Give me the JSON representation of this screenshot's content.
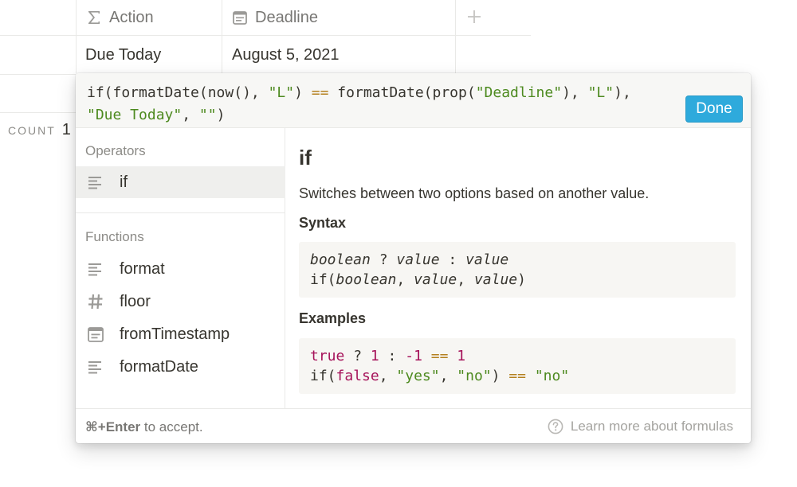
{
  "table": {
    "columns": [
      {
        "name": "Action",
        "icon": "formula-sigma-icon"
      },
      {
        "name": "Deadline",
        "icon": "calendar-icon"
      }
    ],
    "add_column_icon": "plus-icon",
    "row": {
      "action": "Due Today",
      "deadline": "August 5, 2021"
    },
    "count": {
      "label": "COUNT",
      "value": "1"
    }
  },
  "formula_editor": {
    "line1": {
      "t1": "if(formatDate(now(), ",
      "t2": "\"L\"",
      "t3": ") ",
      "t4": "==",
      "t5": " formatDate(prop(",
      "t6": "\"Deadline\"",
      "t7": "), ",
      "t8": "\"L\"",
      "t9": "),"
    },
    "line2": {
      "t1": "\"Due Today\"",
      "t2": ", ",
      "t3": "\"\"",
      "t4": ")"
    },
    "done_label": "Done"
  },
  "sidebar": {
    "operators_label": "Operators",
    "operators": [
      {
        "label": "if",
        "icon": "text-lines-icon",
        "selected": true
      }
    ],
    "functions_label": "Functions",
    "functions": [
      {
        "label": "format",
        "icon": "text-lines-icon"
      },
      {
        "label": "floor",
        "icon": "hash-icon"
      },
      {
        "label": "fromTimestamp",
        "icon": "calendar-icon"
      },
      {
        "label": "formatDate",
        "icon": "text-lines-icon"
      }
    ]
  },
  "doc": {
    "title": "if",
    "description": "Switches between two options based on another value.",
    "syntax_label": "Syntax",
    "syntax_line1": {
      "a": "boolean",
      "b": " ? ",
      "c": "value",
      "d": " : ",
      "e": "value"
    },
    "syntax_line2": {
      "a": "if(",
      "b": "boolean",
      "c": ", ",
      "d": "value",
      "e": ", ",
      "f": "value",
      "g": ")"
    },
    "examples_label": "Examples",
    "example_line1": {
      "a": "true",
      "b": " ? ",
      "c": "1",
      "d": " : ",
      "e": "-1",
      "f": " ",
      "g": "==",
      "h": " ",
      "i": "1"
    },
    "example_line2": {
      "a": "if(",
      "b": "false",
      "c": ", ",
      "d": "\"yes\"",
      "e": ", ",
      "f": "\"no\"",
      "g": ") ",
      "h": "==",
      "i": " ",
      "j": "\"no\""
    }
  },
  "footer": {
    "shortcut": "⌘+Enter",
    "hint_rest": " to accept.",
    "learn_more": "Learn more about formulas",
    "help_icon": "question-circle-icon"
  },
  "colors": {
    "accent": "#2eaadc",
    "string": "#4d8a1f",
    "operator": "#b4801f",
    "keyword": "#a6135a"
  }
}
